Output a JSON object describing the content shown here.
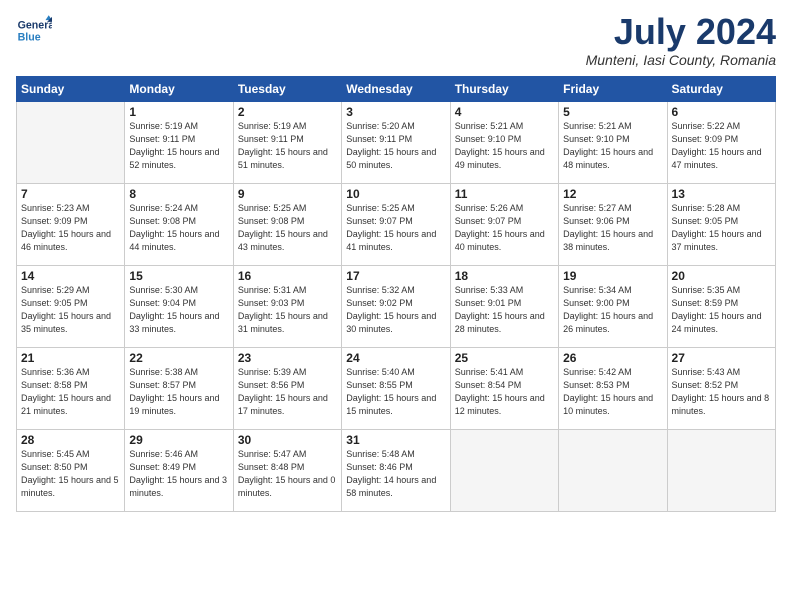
{
  "header": {
    "logo_line1": "General",
    "logo_line2": "Blue",
    "month": "July 2024",
    "location": "Munteni, Iasi County, Romania"
  },
  "weekdays": [
    "Sunday",
    "Monday",
    "Tuesday",
    "Wednesday",
    "Thursday",
    "Friday",
    "Saturday"
  ],
  "weeks": [
    [
      {
        "day": "",
        "empty": true
      },
      {
        "day": "1",
        "sunrise": "5:19 AM",
        "sunset": "9:11 PM",
        "daylight": "15 hours and 52 minutes."
      },
      {
        "day": "2",
        "sunrise": "5:19 AM",
        "sunset": "9:11 PM",
        "daylight": "15 hours and 51 minutes."
      },
      {
        "day": "3",
        "sunrise": "5:20 AM",
        "sunset": "9:11 PM",
        "daylight": "15 hours and 50 minutes."
      },
      {
        "day": "4",
        "sunrise": "5:21 AM",
        "sunset": "9:10 PM",
        "daylight": "15 hours and 49 minutes."
      },
      {
        "day": "5",
        "sunrise": "5:21 AM",
        "sunset": "9:10 PM",
        "daylight": "15 hours and 48 minutes."
      },
      {
        "day": "6",
        "sunrise": "5:22 AM",
        "sunset": "9:09 PM",
        "daylight": "15 hours and 47 minutes."
      }
    ],
    [
      {
        "day": "7",
        "sunrise": "5:23 AM",
        "sunset": "9:09 PM",
        "daylight": "15 hours and 46 minutes."
      },
      {
        "day": "8",
        "sunrise": "5:24 AM",
        "sunset": "9:08 PM",
        "daylight": "15 hours and 44 minutes."
      },
      {
        "day": "9",
        "sunrise": "5:25 AM",
        "sunset": "9:08 PM",
        "daylight": "15 hours and 43 minutes."
      },
      {
        "day": "10",
        "sunrise": "5:25 AM",
        "sunset": "9:07 PM",
        "daylight": "15 hours and 41 minutes."
      },
      {
        "day": "11",
        "sunrise": "5:26 AM",
        "sunset": "9:07 PM",
        "daylight": "15 hours and 40 minutes."
      },
      {
        "day": "12",
        "sunrise": "5:27 AM",
        "sunset": "9:06 PM",
        "daylight": "15 hours and 38 minutes."
      },
      {
        "day": "13",
        "sunrise": "5:28 AM",
        "sunset": "9:05 PM",
        "daylight": "15 hours and 37 minutes."
      }
    ],
    [
      {
        "day": "14",
        "sunrise": "5:29 AM",
        "sunset": "9:05 PM",
        "daylight": "15 hours and 35 minutes."
      },
      {
        "day": "15",
        "sunrise": "5:30 AM",
        "sunset": "9:04 PM",
        "daylight": "15 hours and 33 minutes."
      },
      {
        "day": "16",
        "sunrise": "5:31 AM",
        "sunset": "9:03 PM",
        "daylight": "15 hours and 31 minutes."
      },
      {
        "day": "17",
        "sunrise": "5:32 AM",
        "sunset": "9:02 PM",
        "daylight": "15 hours and 30 minutes."
      },
      {
        "day": "18",
        "sunrise": "5:33 AM",
        "sunset": "9:01 PM",
        "daylight": "15 hours and 28 minutes."
      },
      {
        "day": "19",
        "sunrise": "5:34 AM",
        "sunset": "9:00 PM",
        "daylight": "15 hours and 26 minutes."
      },
      {
        "day": "20",
        "sunrise": "5:35 AM",
        "sunset": "8:59 PM",
        "daylight": "15 hours and 24 minutes."
      }
    ],
    [
      {
        "day": "21",
        "sunrise": "5:36 AM",
        "sunset": "8:58 PM",
        "daylight": "15 hours and 21 minutes."
      },
      {
        "day": "22",
        "sunrise": "5:38 AM",
        "sunset": "8:57 PM",
        "daylight": "15 hours and 19 minutes."
      },
      {
        "day": "23",
        "sunrise": "5:39 AM",
        "sunset": "8:56 PM",
        "daylight": "15 hours and 17 minutes."
      },
      {
        "day": "24",
        "sunrise": "5:40 AM",
        "sunset": "8:55 PM",
        "daylight": "15 hours and 15 minutes."
      },
      {
        "day": "25",
        "sunrise": "5:41 AM",
        "sunset": "8:54 PM",
        "daylight": "15 hours and 12 minutes."
      },
      {
        "day": "26",
        "sunrise": "5:42 AM",
        "sunset": "8:53 PM",
        "daylight": "15 hours and 10 minutes."
      },
      {
        "day": "27",
        "sunrise": "5:43 AM",
        "sunset": "8:52 PM",
        "daylight": "15 hours and 8 minutes."
      }
    ],
    [
      {
        "day": "28",
        "sunrise": "5:45 AM",
        "sunset": "8:50 PM",
        "daylight": "15 hours and 5 minutes."
      },
      {
        "day": "29",
        "sunrise": "5:46 AM",
        "sunset": "8:49 PM",
        "daylight": "15 hours and 3 minutes."
      },
      {
        "day": "30",
        "sunrise": "5:47 AM",
        "sunset": "8:48 PM",
        "daylight": "15 hours and 0 minutes."
      },
      {
        "day": "31",
        "sunrise": "5:48 AM",
        "sunset": "8:46 PM",
        "daylight": "14 hours and 58 minutes."
      },
      {
        "day": "",
        "empty": true
      },
      {
        "day": "",
        "empty": true
      },
      {
        "day": "",
        "empty": true
      }
    ]
  ]
}
